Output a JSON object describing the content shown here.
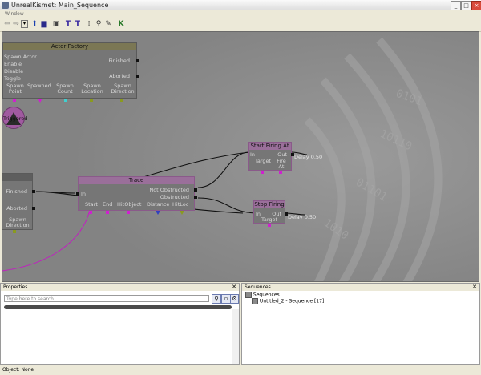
{
  "window": {
    "title": "UnrealKismet: Main_Sequence"
  },
  "menu": {
    "window": "Window"
  },
  "nodes": {
    "actor_factory": {
      "title": "Actor Factory",
      "left_pins": [
        "Spawn Actor",
        "Enable",
        "Disable",
        "Toggle"
      ],
      "right_pins": [
        "Finished",
        "Aborted"
      ],
      "bottom_pins": [
        "Spawn Point",
        "Spawned",
        "Spawn Count",
        "Spawn Location",
        "Spawn Direction"
      ]
    },
    "triggered": {
      "label": "Triggered"
    },
    "left_node": {
      "finished": "Finished",
      "aborted": "Aborted",
      "spawn_direction": "Spawn Direction"
    },
    "trace": {
      "title": "Trace",
      "input": "In",
      "outputs": [
        "Not Obstructed",
        "Obstructed"
      ],
      "bottom_pins": [
        "Start",
        "End",
        "HitObject",
        "Distance",
        "HitLoc"
      ]
    },
    "start_firing": {
      "title": "Start Firing At",
      "input": "In",
      "output": "Out",
      "bottom_pins": [
        "Target",
        "Fire At"
      ]
    },
    "stop_firing": {
      "title": "Stop Firing",
      "input": "In",
      "output": "Out",
      "bottom_pins": [
        "Target"
      ]
    }
  },
  "annotations": {
    "delay1": "Delay 0.50",
    "delay2": "Delay 0.50"
  },
  "properties": {
    "title": "Properties",
    "search_placeholder": "Type here to search"
  },
  "sequences": {
    "title": "Sequences",
    "root": "Sequences",
    "child": "Untitled_2 - Sequence [17]"
  },
  "status": {
    "object": "Object: None"
  },
  "colors": {
    "canvas": "#8a8a8a",
    "pin_magenta": "#d020d0",
    "pin_cyan": "#40d0d0",
    "pin_olive": "#8a9a20",
    "pin_blue": "#3040c0"
  }
}
